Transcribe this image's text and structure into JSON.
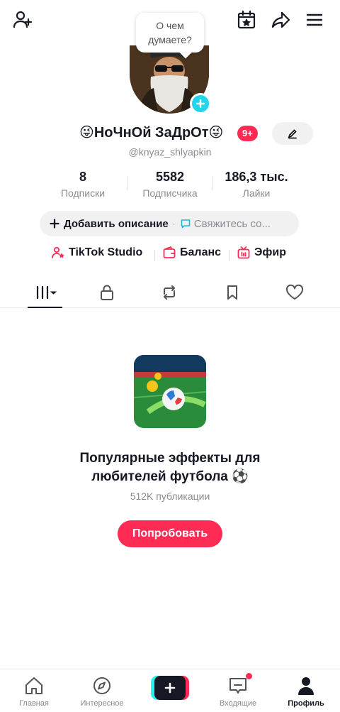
{
  "bubble": {
    "line1": "О чем",
    "line2": "думаете?"
  },
  "profile": {
    "display_name": "😜НоЧнОй ЗаДрОт😜",
    "notif_badge": "9+",
    "username": "@knyaz_shlyapkin"
  },
  "stats": [
    {
      "value": "8",
      "label": "Подписки"
    },
    {
      "value": "5582",
      "label": "Подписчика"
    },
    {
      "value": "186,3 тыс.",
      "label": "Лайки"
    }
  ],
  "description": {
    "add_label": "Добавить описание",
    "separator": "·",
    "contact_label": "Свяжитесь со..."
  },
  "quick_links": {
    "studio": "TikTok Studio",
    "balance": "Баланс",
    "live": "Эфир"
  },
  "empty_state": {
    "title_line1": "Популярные эффекты для",
    "title_line2": "любителей футбола ⚽",
    "subtitle": "512K публикации",
    "button": "Попробовать"
  },
  "bottom_nav": {
    "home": "Главная",
    "discover": "Интересное",
    "inbox": "Входящие",
    "profile": "Профиль"
  },
  "colors": {
    "accent": "#fe2c55",
    "cyan": "#20d5ec",
    "text": "#161823",
    "muted": "#8a8b91"
  },
  "icons": {
    "top": [
      "add-user-icon",
      "calendar-star-icon",
      "share-icon",
      "menu-icon"
    ],
    "tabs": [
      "videos-grid-icon",
      "lock-icon",
      "repost-icon",
      "bookmark-icon",
      "heart-icon"
    ]
  }
}
